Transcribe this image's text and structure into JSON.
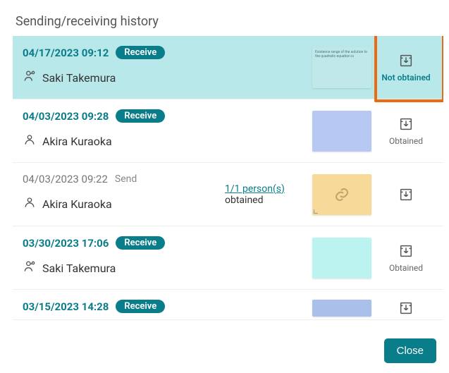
{
  "header": {
    "title": "Sending/receiving history"
  },
  "labels": {
    "receive": "Receive",
    "send": "Send",
    "obtained": "Obtained",
    "not_obtained": "Not obtained",
    "close": "Close"
  },
  "rows": [
    {
      "timestamp": "04/17/2023 09:12",
      "kind": "receive",
      "person": "Saki Takemura",
      "thumb_text": "Existence range of the solution to the quadratic equation is",
      "action_label_key": "not_obtained"
    },
    {
      "timestamp": "04/03/2023 09:28",
      "kind": "receive",
      "person": "Akira Kuraoka",
      "action_label_key": "obtained"
    },
    {
      "timestamp": "04/03/2023 09:22",
      "kind": "send",
      "person": "Akira Kuraoka",
      "mid_link": "1/1 person(s)",
      "mid_text": "obtained"
    },
    {
      "timestamp": "03/30/2023 17:06",
      "kind": "receive",
      "person": "Saki Takemura",
      "action_label_key": "obtained"
    },
    {
      "timestamp": "03/15/2023 14:28",
      "kind": "receive",
      "person": ""
    }
  ]
}
